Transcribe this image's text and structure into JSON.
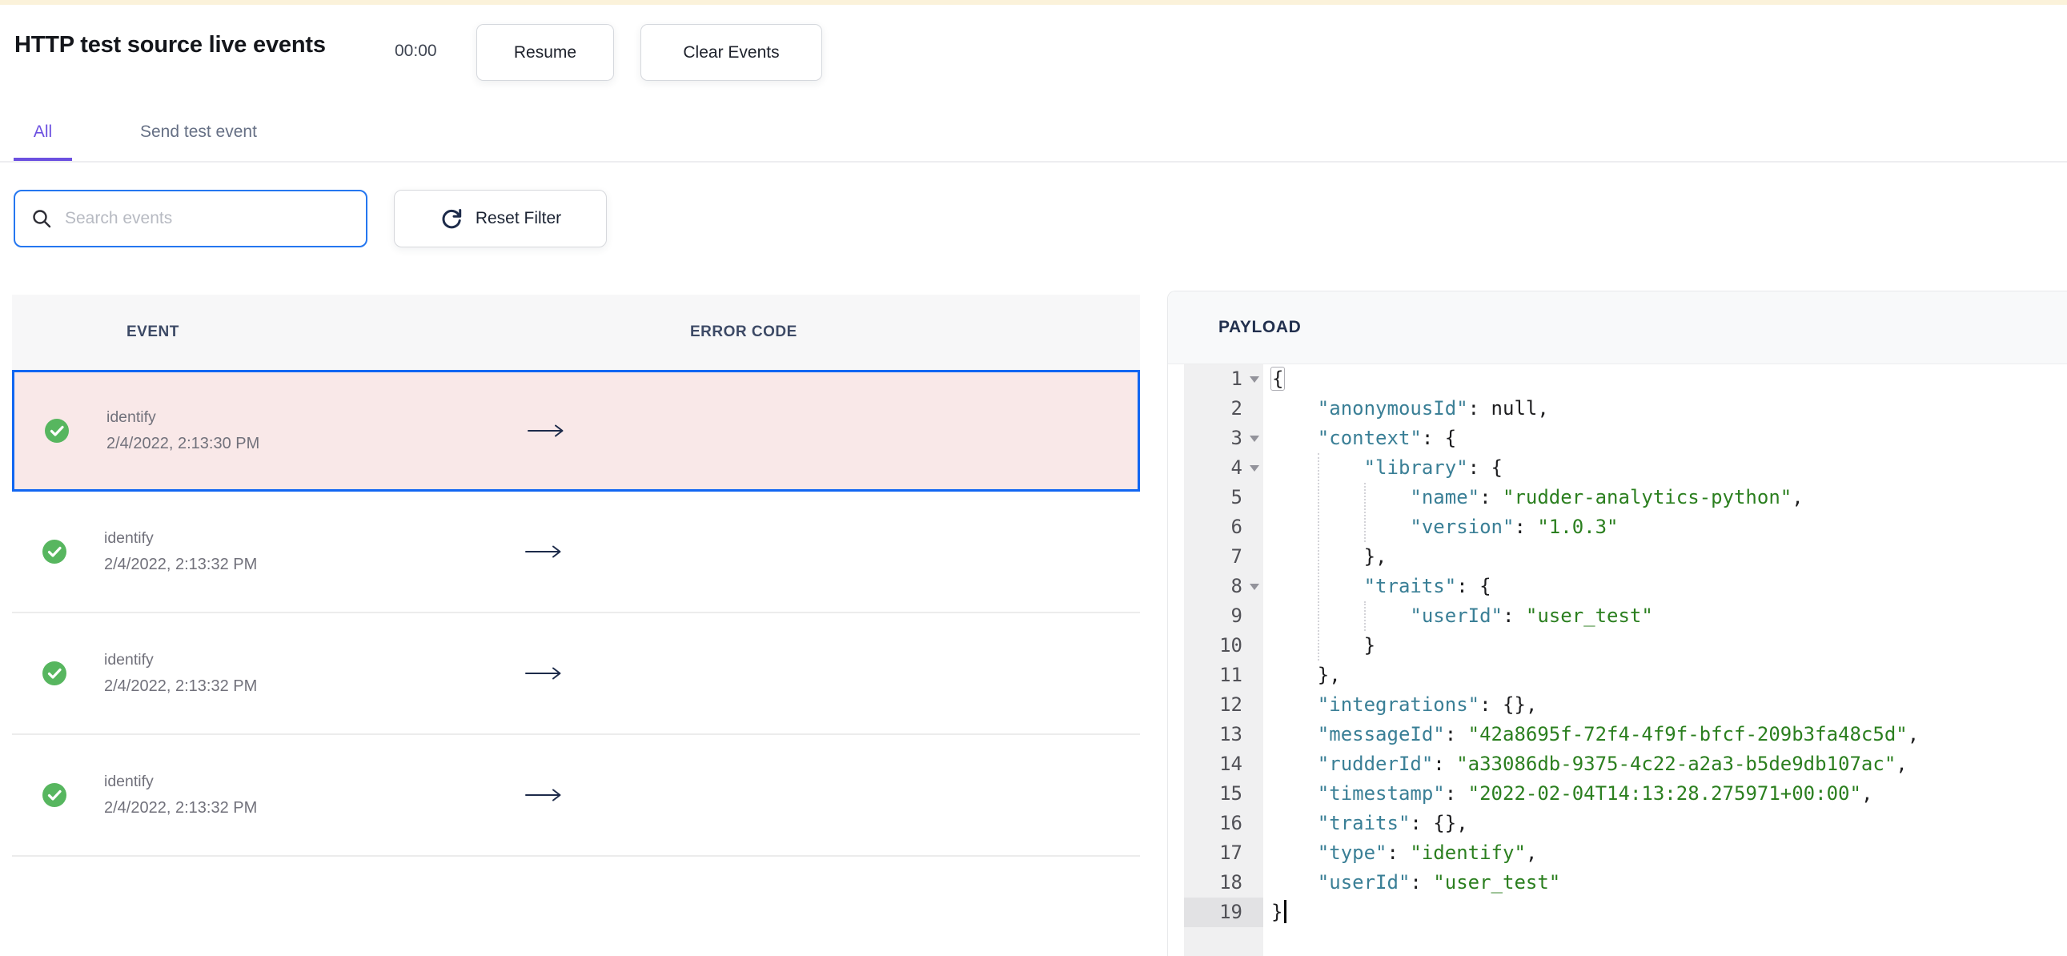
{
  "header": {
    "title": "HTTP test source live events",
    "timer": "00:00",
    "resume_label": "Resume",
    "clear_label": "Clear Events"
  },
  "tabs": [
    {
      "label": "All",
      "active": true
    },
    {
      "label": "Send test event",
      "active": false
    }
  ],
  "filter_bar": {
    "search_placeholder": "Search events",
    "search_value": "",
    "reset_label": "Reset Filter",
    "search_icon": "magnifier",
    "reset_icon": "circular-refresh-arrow"
  },
  "events_table": {
    "columns": [
      "EVENT",
      "ERROR CODE"
    ],
    "status_icon": "green-check-circle",
    "row_action_icon": "long-right-arrow",
    "rows": [
      {
        "event": "identify",
        "timestamp": "2/4/2022, 2:13:30 PM",
        "status": "success",
        "selected": true,
        "error_code": ""
      },
      {
        "event": "identify",
        "timestamp": "2/4/2022, 2:13:32 PM",
        "status": "success",
        "selected": false,
        "error_code": ""
      },
      {
        "event": "identify",
        "timestamp": "2/4/2022, 2:13:32 PM",
        "status": "success",
        "selected": false,
        "error_code": ""
      },
      {
        "event": "identify",
        "timestamp": "2/4/2022, 2:13:32 PM",
        "status": "success",
        "selected": false,
        "error_code": ""
      }
    ]
  },
  "payload_panel": {
    "title": "PAYLOAD",
    "active_line": 19,
    "fold_lines": [
      1,
      3,
      4,
      8
    ],
    "lines": [
      {
        "tokens": [
          {
            "c": "b",
            "v": "{"
          }
        ]
      },
      {
        "tokens": [
          {
            "c": "w",
            "v": "    "
          },
          {
            "c": "k",
            "v": "\"anonymousId\""
          },
          {
            "c": "w",
            "v": ": null,"
          }
        ]
      },
      {
        "tokens": [
          {
            "c": "w",
            "v": "    "
          },
          {
            "c": "k",
            "v": "\"context\""
          },
          {
            "c": "w",
            "v": ": {"
          }
        ]
      },
      {
        "tokens": [
          {
            "c": "w",
            "v": "        "
          },
          {
            "c": "k",
            "v": "\"library\""
          },
          {
            "c": "w",
            "v": ": {"
          }
        ]
      },
      {
        "tokens": [
          {
            "c": "w",
            "v": "            "
          },
          {
            "c": "k",
            "v": "\"name\""
          },
          {
            "c": "w",
            "v": ": "
          },
          {
            "c": "s",
            "v": "\"rudder-analytics-python\""
          },
          {
            "c": "w",
            "v": ","
          }
        ]
      },
      {
        "tokens": [
          {
            "c": "w",
            "v": "            "
          },
          {
            "c": "k",
            "v": "\"version\""
          },
          {
            "c": "w",
            "v": ": "
          },
          {
            "c": "s",
            "v": "\"1.0.3\""
          }
        ]
      },
      {
        "tokens": [
          {
            "c": "w",
            "v": "        },"
          }
        ]
      },
      {
        "tokens": [
          {
            "c": "w",
            "v": "        "
          },
          {
            "c": "k",
            "v": "\"traits\""
          },
          {
            "c": "w",
            "v": ": {"
          }
        ]
      },
      {
        "tokens": [
          {
            "c": "w",
            "v": "            "
          },
          {
            "c": "k",
            "v": "\"userId\""
          },
          {
            "c": "w",
            "v": ": "
          },
          {
            "c": "s",
            "v": "\"user_test\""
          }
        ]
      },
      {
        "tokens": [
          {
            "c": "w",
            "v": "        }"
          }
        ]
      },
      {
        "tokens": [
          {
            "c": "w",
            "v": "    },"
          }
        ]
      },
      {
        "tokens": [
          {
            "c": "w",
            "v": "    "
          },
          {
            "c": "k",
            "v": "\"integrations\""
          },
          {
            "c": "w",
            "v": ": {},"
          }
        ]
      },
      {
        "tokens": [
          {
            "c": "w",
            "v": "    "
          },
          {
            "c": "k",
            "v": "\"messageId\""
          },
          {
            "c": "w",
            "v": ": "
          },
          {
            "c": "s",
            "v": "\"42a8695f-72f4-4f9f-bfcf-209b3fa48c5d\""
          },
          {
            "c": "w",
            "v": ","
          }
        ]
      },
      {
        "tokens": [
          {
            "c": "w",
            "v": "    "
          },
          {
            "c": "k",
            "v": "\"rudderId\""
          },
          {
            "c": "w",
            "v": ": "
          },
          {
            "c": "s",
            "v": "\"a33086db-9375-4c22-a2a3-b5de9db107ac\""
          },
          {
            "c": "w",
            "v": ","
          }
        ]
      },
      {
        "tokens": [
          {
            "c": "w",
            "v": "    "
          },
          {
            "c": "k",
            "v": "\"timestamp\""
          },
          {
            "c": "w",
            "v": ": "
          },
          {
            "c": "s",
            "v": "\"2022-02-04T14:13:28.275971+00:00\""
          },
          {
            "c": "w",
            "v": ","
          }
        ]
      },
      {
        "tokens": [
          {
            "c": "w",
            "v": "    "
          },
          {
            "c": "k",
            "v": "\"traits\""
          },
          {
            "c": "w",
            "v": ": {},"
          }
        ]
      },
      {
        "tokens": [
          {
            "c": "w",
            "v": "    "
          },
          {
            "c": "k",
            "v": "\"type\""
          },
          {
            "c": "w",
            "v": ": "
          },
          {
            "c": "s",
            "v": "\"identify\""
          },
          {
            "c": "w",
            "v": ","
          }
        ]
      },
      {
        "tokens": [
          {
            "c": "w",
            "v": "    "
          },
          {
            "c": "k",
            "v": "\"userId\""
          },
          {
            "c": "w",
            "v": ": "
          },
          {
            "c": "s",
            "v": "\"user_test\""
          }
        ]
      },
      {
        "tokens": [
          {
            "c": "w",
            "v": "}"
          }
        ]
      }
    ]
  },
  "colors": {
    "accent_purple": "#6c50e0",
    "selected_row_border": "#1166f2",
    "selected_row_bg": "#f9e8e8",
    "success_green": "#57b65f",
    "search_focus_blue": "#2577f0",
    "json_key": "#3a7f96",
    "json_string": "#2b7f1f",
    "top_bar_cream": "#fbf2da",
    "arrow_navy": "#1d2b4a"
  }
}
